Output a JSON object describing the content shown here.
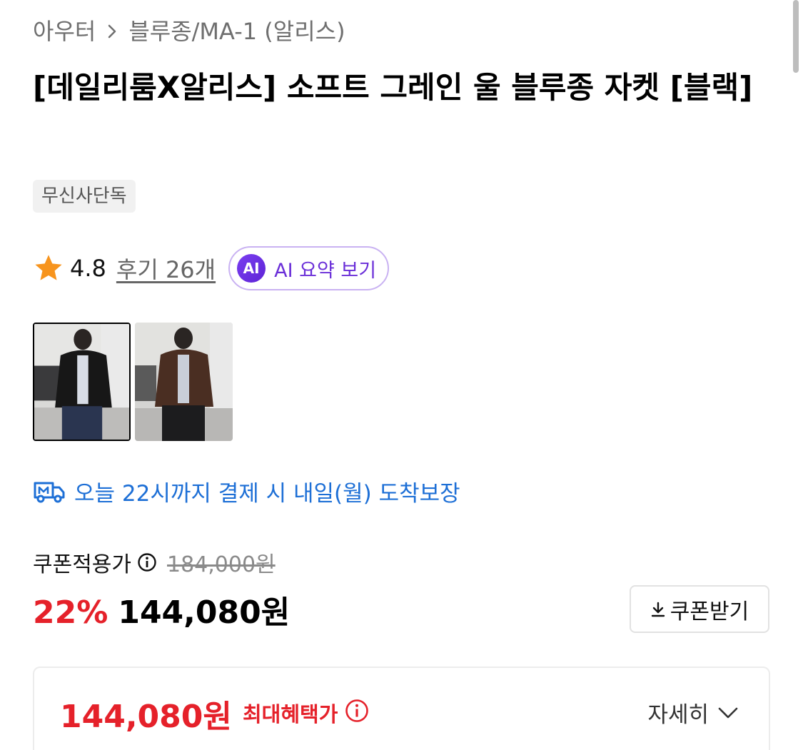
{
  "breadcrumb": {
    "parent": "아우터",
    "current": "블루종/MA-1 (알리스)"
  },
  "product": {
    "title": "[데일리룸X알리스] 소프트 그레인 울 블루종 자켓 [블랙]",
    "badge": "무신사단독"
  },
  "rating": {
    "score": "4.8",
    "reviews": "후기 26개",
    "ai_icon": "AI",
    "ai_label": "AI 요약 보기"
  },
  "thumbnails": [
    {
      "name": "black-jacket-thumbnail",
      "selected": true
    },
    {
      "name": "brown-jacket-thumbnail",
      "selected": false
    }
  ],
  "delivery": {
    "text": "오늘 22시까지 결제 시 내일(월) 도착보장"
  },
  "price": {
    "coupon_label": "쿠폰적용가",
    "original": "184,000원",
    "discount": "22%",
    "sale": "144,080원",
    "coupon_button": "쿠폰받기"
  },
  "benefit": {
    "price": "144,080원",
    "label": "최대혜택가",
    "detail": "자세히"
  },
  "colors": {
    "accent_red": "#e5212a",
    "delivery_blue": "#1d6fd6",
    "ai_purple": "#6a2ed8",
    "star": "#f7941d"
  },
  "icons": [
    "chevron-right-icon",
    "star-icon",
    "ai-icon",
    "truck-icon",
    "info-icon",
    "download-icon",
    "chevron-down-icon"
  ]
}
